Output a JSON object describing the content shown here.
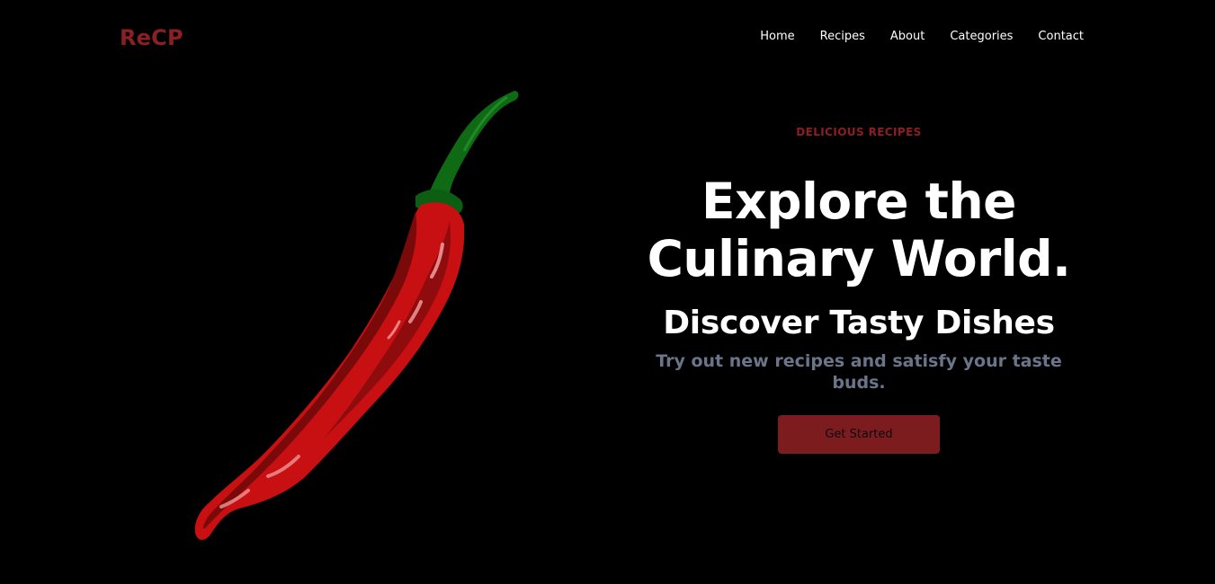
{
  "header": {
    "brand": "ReCP",
    "nav": [
      "Home",
      "Recipes",
      "About",
      "Categories",
      "Contact"
    ]
  },
  "hero": {
    "eyebrow": "DELICIOUS RECIPES",
    "headline_line1": "Explore the",
    "headline_line2": "Culinary World.",
    "subheadline": "Discover Tasty Dishes",
    "tagline": "Try out new recipes and satisfy your taste buds.",
    "cta_label": "Get Started"
  },
  "image": {
    "icon": "chili-pepper-icon"
  },
  "colors": {
    "background": "#000000",
    "accent": "#8b1f22",
    "button": "#7d1c1f",
    "tagline": "#6b7489",
    "pepper_red": "#c80f12",
    "pepper_dark": "#7a0a0a",
    "stem_green": "#0e6b14"
  }
}
